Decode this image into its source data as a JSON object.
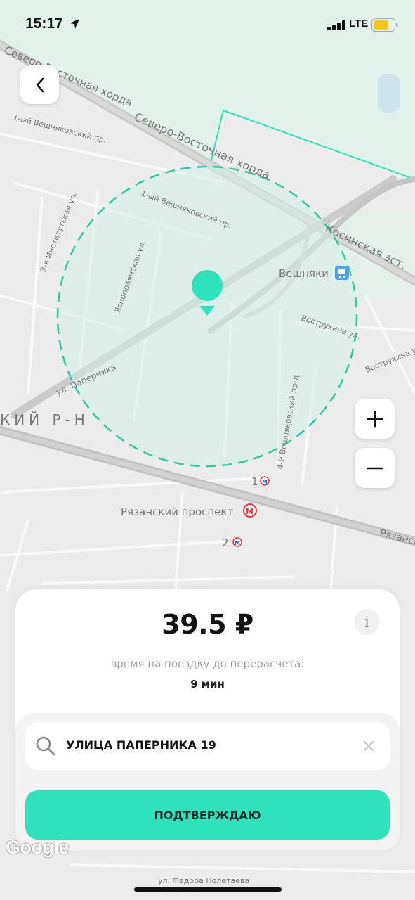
{
  "status_bar": {
    "time": "15:17",
    "network": "LTE",
    "battery_color": "#f5c518"
  },
  "map": {
    "labels": {
      "road_nechord": "Северо-Восточная хорда",
      "road_nechord_top": "Северо-Восточная хорда",
      "road_kosinskaya": "Косинская эст.",
      "station_veshnyaki": "Вешняки",
      "street_veshnyakovsky_1_top": "1-ый Вешняковский пр.",
      "street_veshnyakovsky_1": "1-ый Вешняковский пр.",
      "street_institutskaya": "3-я Институтская ул.",
      "street_yasnopolyanskaya": "Яснополянская ул.",
      "street_vostrukhina": "Вострухина ул.",
      "street_vostrukhina_2": "Вострухина ул.",
      "street_papernika": "ул. Паперника",
      "street_veshnyakovsky_4": "4-й Вешняковский пр-д",
      "district": "КИЙ Р-Н",
      "metro_ryazansky": "Рязанский проспект",
      "exit_1": "1",
      "exit_2": "2",
      "street_ryazansky_right": "Рязанск",
      "street_bottom": "ул. Федора Полетаева"
    },
    "accent_color": "#2ee3bc",
    "metro_color": "#e53935"
  },
  "back_button": {
    "icon": "chevron-left-icon"
  },
  "zoom": {
    "in_icon": "plus-icon",
    "out_icon": "minus-icon"
  },
  "trip": {
    "price": "39.5 ₽",
    "info_icon_label": "i",
    "subtitle": "время на поездку до перерасчета:",
    "duration": "9 мин"
  },
  "address_search": {
    "value": "УЛИЦА ПАПЕРНИКА 19",
    "search_icon": "search-icon",
    "clear_icon": "close-icon"
  },
  "confirm_button": {
    "label": "ПОДТВЕРЖДАЮ"
  },
  "attribution": {
    "google": "Google"
  }
}
